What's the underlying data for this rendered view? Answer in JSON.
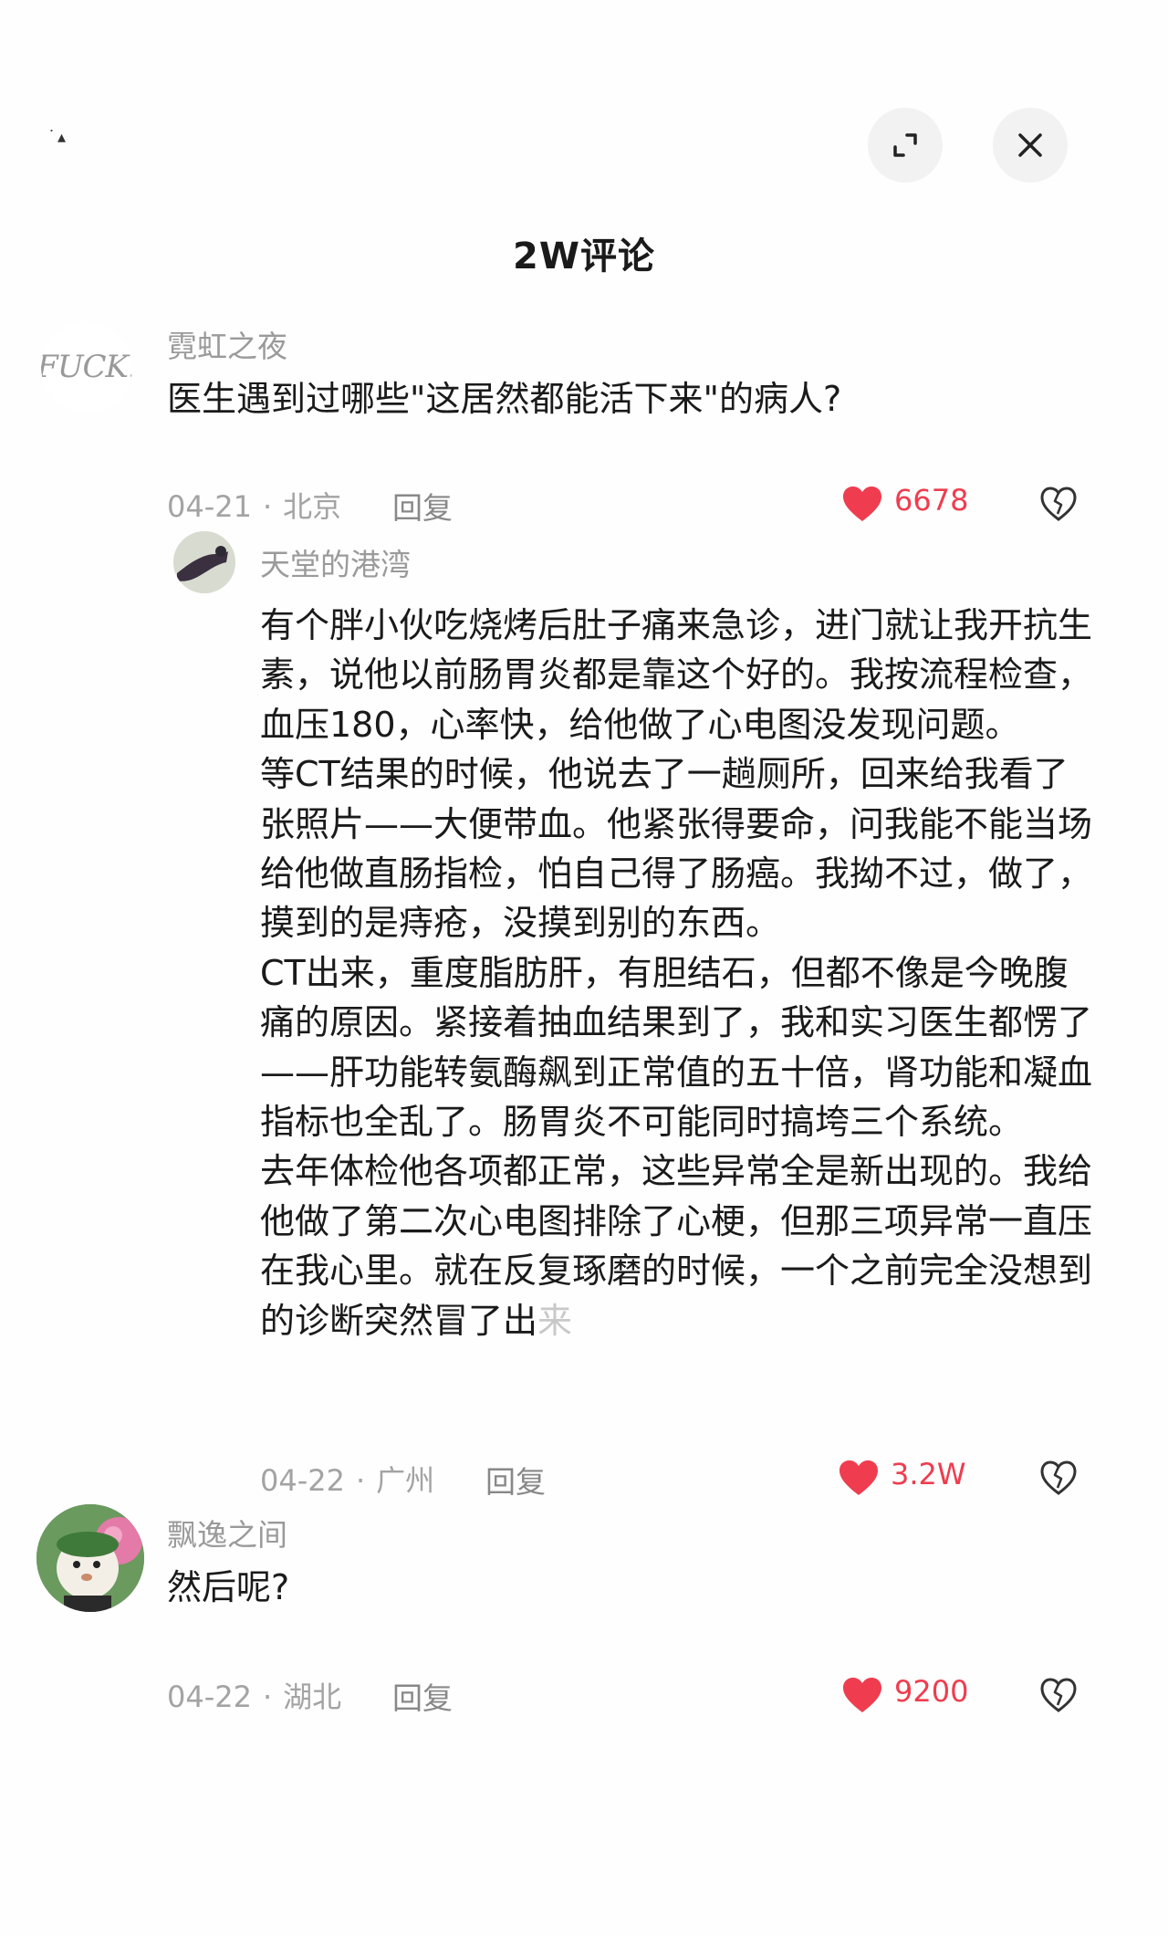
{
  "header": {
    "title": "2W评论",
    "status_mark": "˙▴"
  },
  "comments": [
    {
      "username": "霓虹之夜",
      "avatar_text": "FUCK.",
      "text": "医生遇到过哪些\"这居然都能活下来\"的病人?",
      "date": "04-21",
      "location": "北京",
      "reply_label": "回复",
      "likes": "6678"
    },
    {
      "username": "天堂的港湾",
      "paragraphs": [
        "有个胖小伙吃烧烤后肚子痛来急诊，进门就让我开抗生素，说他以前肠胃炎都是靠这个好的。我按流程检查，血压180，心率快，给他做了心电图没发现问题。",
        "等CT结果的时候，他说去了一趟厕所，回来给我看了张照片——大便带血。他紧张得要命，问我能不能当场给他做直肠指检，怕自己得了肠癌。我拗不过，做了，摸到的是痔疮，没摸到别的东西。",
        "CT出来，重度脂肪肝，有胆结石，但都不像是今晚腹痛的原因。紧接着抽血结果到了，我和实习医生都愣了——肝功能转氨酶飙到正常值的五十倍，肾功能和凝血指标也全乱了。肠胃炎不可能同时搞垮三个系统。"
      ],
      "last_paragraph_main": "去年体检他各项都正常，这些异常全是新出现的。我给他做了第二次心电图排除了心梗，但那三项异常一直压在我心里。就在反复琢磨的时候，一个之前完全没想到的诊断突然冒了出",
      "last_paragraph_tail": "来",
      "date": "04-22",
      "location": "广州",
      "reply_label": "回复",
      "likes": "3.2W"
    },
    {
      "username": "飘逸之间",
      "text": "然后呢?",
      "date": "04-22",
      "location": "湖北",
      "reply_label": "回复",
      "likes": "9200"
    }
  ],
  "icons": {
    "expand": "expand-icon",
    "close": "close-icon",
    "like": "heart-icon",
    "dislike": "broken-heart-icon"
  },
  "colors": {
    "like_red": "#ef3d4f",
    "meta_gray": "#a3a3a3",
    "username_gray": "#9a9a9a"
  }
}
